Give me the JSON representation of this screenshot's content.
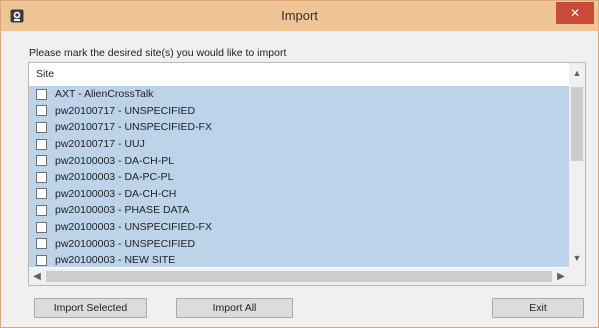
{
  "window": {
    "title": "Import",
    "close_icon": "close-icon",
    "app_icon": "import-app-icon"
  },
  "instruction": "Please mark the desired site(s) you would like to import",
  "list": {
    "header": "Site",
    "items": [
      {
        "label": "AXT - AlienCrossTalk",
        "checked": false
      },
      {
        "label": "pw20100717 - UNSPECIFIED",
        "checked": false
      },
      {
        "label": "pw20100717 - UNSPECIFIED-FX",
        "checked": false
      },
      {
        "label": "pw20100717 - UUJ",
        "checked": false
      },
      {
        "label": "pw20100003 - DA-CH-PL",
        "checked": false
      },
      {
        "label": "pw20100003 - DA-PC-PL",
        "checked": false
      },
      {
        "label": "pw20100003 - DA-CH-CH",
        "checked": false
      },
      {
        "label": "pw20100003 - PHASE DATA",
        "checked": false
      },
      {
        "label": "pw20100003 - UNSPECIFIED-FX",
        "checked": false
      },
      {
        "label": "pw20100003 - UNSPECIFIED",
        "checked": false
      },
      {
        "label": "pw20100003 - NEW SITE",
        "checked": false
      }
    ],
    "selection_color": "#bcd3ea"
  },
  "buttons": {
    "import_selected": "Import Selected",
    "import_all": "Import All",
    "exit": "Exit"
  },
  "colors": {
    "titlebar": "#f0c596",
    "close_button": "#c84a39"
  }
}
